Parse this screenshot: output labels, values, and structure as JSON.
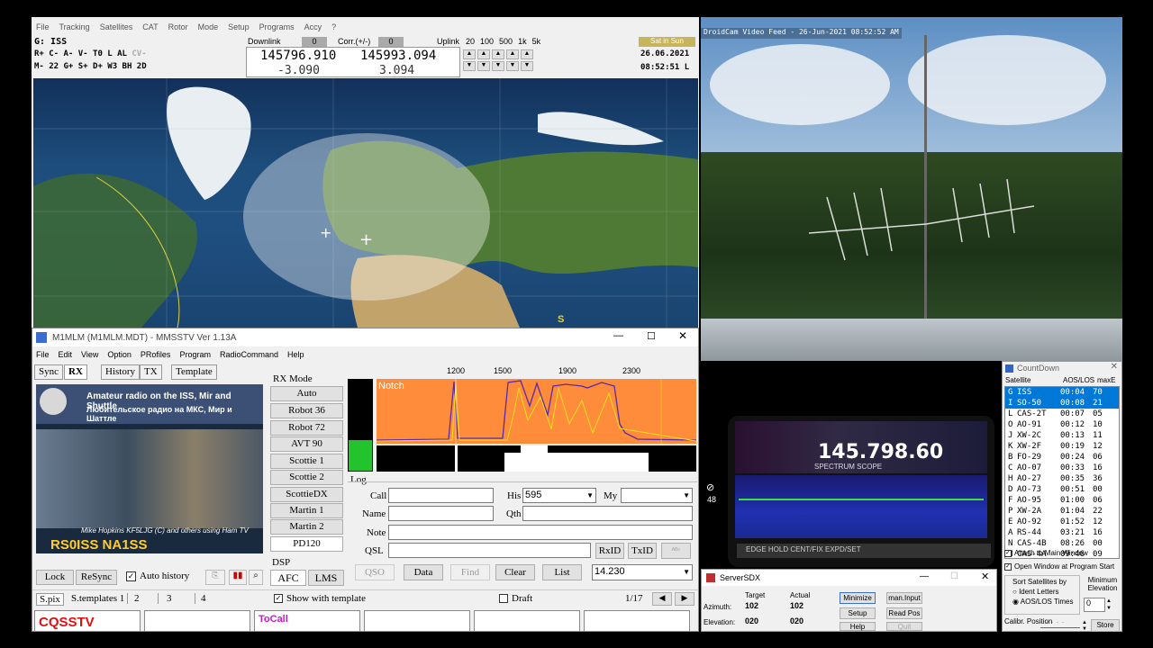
{
  "tracker": {
    "menu": [
      "File",
      "Tracking",
      "Satellites",
      "CAT",
      "Rotor",
      "Mode",
      "Setup",
      "Programs",
      "Accy",
      "?"
    ],
    "sat_name": "G: ISS",
    "status1": "R+ C- A- V- T0 L AL",
    "status1b": "CV-",
    "status2": "M- 22 G+ S+ D+ W3 BH 2D",
    "downlink_label": "Downlink",
    "downlink_val": "0",
    "corr_label": "Corr.(+/-)",
    "corr_val": "0",
    "uplink_label": "Uplink",
    "steps": [
      "20",
      "100",
      "500",
      "1k",
      "5k"
    ],
    "freq_down": "145796.910",
    "freq_up": "145993.094",
    "doppler_down": "-3.090",
    "doppler_up": "3.094",
    "sat_in_sun": "Sat in Sun",
    "date": "26.06.2021",
    "time": "08:52:51 L",
    "map_letter": "S"
  },
  "mmsstv": {
    "title": "M1MLM (M1MLM.MDT) - MMSSTV Ver 1.13A",
    "menu": [
      "File",
      "Edit",
      "View",
      "Option",
      "PRofiles",
      "Program",
      "RadioCommand",
      "Help"
    ],
    "tabs": [
      "Sync",
      "RX",
      "History",
      "TX",
      "Template"
    ],
    "image_title": "Amateur radio on the ISS, Mir and Shuttle",
    "image_subtitle": "Любительское радио на МКС, Мир и Шаттле",
    "image_caption": "Mike Hopkins KF5LJG (C) and others using Ham TV",
    "image_call": "RS0ISS  NA1SS",
    "rx_mode_label": "RX Mode",
    "modes": [
      "Auto",
      "Robot 36",
      "Robot 72",
      "AVT 90",
      "Scottie 1",
      "Scottie 2",
      "ScottieDX",
      "Martin 1",
      "Martin 2",
      "PD120"
    ],
    "dsp_label": "DSP",
    "afc": "AFC",
    "lms": "LMS",
    "lock": "Lock",
    "resync": "ReSync",
    "auto_history": "Auto history",
    "spectrum_ticks": [
      "1200",
      "1500",
      "1900",
      "2300"
    ],
    "notch": "Notch",
    "log_label": "Log",
    "call_label": "Call",
    "his_label": "His",
    "his_val": "595",
    "my_label": "My",
    "name_label": "Name",
    "qth_label": "Qth",
    "note_label": "Note",
    "qsl_label": "QSL",
    "rxid": "RxID",
    "txid": "TxID",
    "qso": "QSO",
    "data": "Data",
    "find": "Find",
    "clear": "Clear",
    "list": "List",
    "freq": "14.230",
    "bottom_tabs": [
      "S.pix",
      "S.templates 1",
      "2",
      "3",
      "4"
    ],
    "show_template": "Show with template",
    "draft": "Draft",
    "page": "1/17",
    "thumb1": "CQSSTV",
    "thumb2": "ToCall"
  },
  "camera": {
    "overlay": "DroidCam Video Feed - 26-Jun-2021 08:52:52 AM",
    "radio_freq": "145.798.60",
    "radio_scope": "SPECTRUM SCOPE",
    "radio_buttons": "EDGE    HOLD    CENT/FIX  EXPD/SET",
    "timer_val": "48"
  },
  "countdown": {
    "title": "CountDown",
    "col_sat": "Satellite",
    "col_aos": "AOS/LOS",
    "col_max": "maxE",
    "rows": [
      {
        "k": "G",
        "n": "ISS",
        "t": "00:04",
        "e": "70"
      },
      {
        "k": "I",
        "n": "SO-50",
        "t": "00:08",
        "e": "21"
      },
      {
        "k": "L",
        "n": "CAS-2T",
        "t": "00:07",
        "e": "05"
      },
      {
        "k": "O",
        "n": "AO-91",
        "t": "00:12",
        "e": "10"
      },
      {
        "k": "J",
        "n": "XW-2C",
        "t": "00:13",
        "e": "11"
      },
      {
        "k": "K",
        "n": "XW-2F",
        "t": "00:19",
        "e": "12"
      },
      {
        "k": "B",
        "n": "FO-29",
        "t": "00:24",
        "e": "06"
      },
      {
        "k": "C",
        "n": "AO-07",
        "t": "00:33",
        "e": "16"
      },
      {
        "k": "H",
        "n": "AO-27",
        "t": "00:35",
        "e": "36"
      },
      {
        "k": "D",
        "n": "AO-73",
        "t": "00:51",
        "e": "00"
      },
      {
        "k": "F",
        "n": "AO-95",
        "t": "01:00",
        "e": "06"
      },
      {
        "k": "P",
        "n": "XW-2A",
        "t": "01:04",
        "e": "22"
      },
      {
        "k": "E",
        "n": "AO-92",
        "t": "01:52",
        "e": "12"
      },
      {
        "k": "A",
        "n": "RS-44",
        "t": "03:21",
        "e": "16"
      },
      {
        "k": "N",
        "n": "CAS-4B",
        "t": "08:26",
        "e": "00"
      },
      {
        "k": "M",
        "n": "CAS-4A",
        "t": "09:46",
        "e": "09"
      }
    ],
    "attach": "Attach to Main Window",
    "open_start": "Open Window at Program Start",
    "sort_label": "Sort Satellites by",
    "ident": "Ident Letters",
    "aoslos": "AOS/LOS Times",
    "min_elev_label": "Minimum Elevation",
    "min_elev_val": "0",
    "calib": "Calibr. Position",
    "store": "Store"
  },
  "sdx": {
    "title": "ServerSDX",
    "target": "Target",
    "actual": "Actual",
    "azimuth": "Azimuth:",
    "elevation": "Elevation:",
    "az_target": "102",
    "az_actual": "102",
    "el_target": "020",
    "el_actual": "020",
    "minimize": "Minimize",
    "man_input": "man.Input",
    "setup": "Setup",
    "read_pos": "Read Pos",
    "help": "Help",
    "quit": "Quit"
  }
}
